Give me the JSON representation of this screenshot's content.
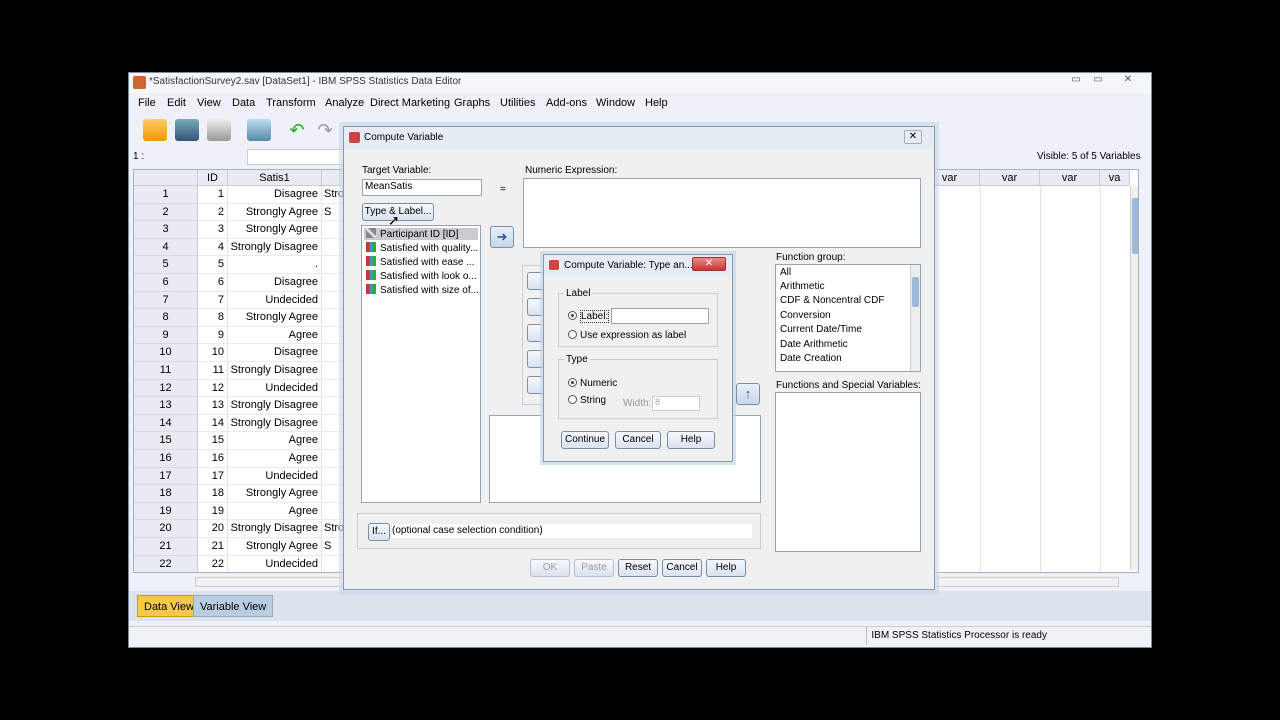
{
  "window": {
    "title": "*SatisfactionSurvey2.sav [DataSet1] - IBM SPSS Statistics Data Editor",
    "controls": {
      "minimize": "▭",
      "maximize": "▭",
      "close": "✕"
    }
  },
  "menu": [
    "File",
    "Edit",
    "View",
    "Data",
    "Transform",
    "Analyze",
    "Direct Marketing",
    "Graphs",
    "Utilities",
    "Add-ons",
    "Window",
    "Help"
  ],
  "cell_ref": "1 :",
  "visible": "Visible: 5 of 5 Variables",
  "grid": {
    "columns": [
      "ID",
      "Satis1",
      "var",
      "var",
      "var",
      "va"
    ],
    "rows": [
      {
        "n": "1",
        "id": "1",
        "s1": "Disagree",
        "s2": "Stro"
      },
      {
        "n": "2",
        "id": "2",
        "s1": "Strongly Agree",
        "s2": "S"
      },
      {
        "n": "3",
        "id": "3",
        "s1": "Strongly Agree",
        "s2": ""
      },
      {
        "n": "4",
        "id": "4",
        "s1": "Strongly Disagree",
        "s2": ""
      },
      {
        "n": "5",
        "id": "5",
        "s1": ".",
        "s2": ""
      },
      {
        "n": "6",
        "id": "6",
        "s1": "Disagree",
        "s2": ""
      },
      {
        "n": "7",
        "id": "7",
        "s1": "Undecided",
        "s2": ""
      },
      {
        "n": "8",
        "id": "8",
        "s1": "Strongly Agree",
        "s2": ""
      },
      {
        "n": "9",
        "id": "9",
        "s1": "Agree",
        "s2": ""
      },
      {
        "n": "10",
        "id": "10",
        "s1": "Disagree",
        "s2": ""
      },
      {
        "n": "11",
        "id": "11",
        "s1": "Strongly Disagree",
        "s2": ""
      },
      {
        "n": "12",
        "id": "12",
        "s1": "Undecided",
        "s2": ""
      },
      {
        "n": "13",
        "id": "13",
        "s1": "Strongly Disagree",
        "s2": ""
      },
      {
        "n": "14",
        "id": "14",
        "s1": "Strongly Disagree",
        "s2": ""
      },
      {
        "n": "15",
        "id": "15",
        "s1": "Agree",
        "s2": ""
      },
      {
        "n": "16",
        "id": "16",
        "s1": "Agree",
        "s2": ""
      },
      {
        "n": "17",
        "id": "17",
        "s1": "Undecided",
        "s2": ""
      },
      {
        "n": "18",
        "id": "18",
        "s1": "Strongly Agree",
        "s2": ""
      },
      {
        "n": "19",
        "id": "19",
        "s1": "Agree",
        "s2": ""
      },
      {
        "n": "20",
        "id": "20",
        "s1": "Strongly Disagree",
        "s2": "Stro"
      },
      {
        "n": "21",
        "id": "21",
        "s1": "Strongly Agree",
        "s2": "S"
      },
      {
        "n": "22",
        "id": "22",
        "s1": "Undecided",
        "s2": ""
      }
    ]
  },
  "view_tabs": {
    "data": "Data View",
    "variable": "Variable View"
  },
  "status": "IBM SPSS Statistics Processor is ready",
  "compute": {
    "title": "Compute Variable",
    "target_label": "Target Variable:",
    "target_value": "MeanSatis",
    "equals": "=",
    "expr_label": "Numeric Expression:",
    "type_label_btn": "Type & Label...",
    "variables": [
      "Participant ID [ID]",
      "Satisfied with quality...",
      "Satisfied with ease ...",
      "Satisfied with look o...",
      "Satisfied with size of..."
    ],
    "function_group_label": "Function group:",
    "function_groups": [
      "All",
      "Arithmetic",
      "CDF & Noncentral CDF",
      "Conversion",
      "Current Date/Time",
      "Date Arithmetic",
      "Date Creation"
    ],
    "functions_label": "Functions and Special Variables:",
    "if_btn": "If...",
    "if_text": "(optional case selection condition)",
    "buttons": {
      "ok": "OK",
      "paste": "Paste",
      "reset": "Reset",
      "cancel": "Cancel",
      "help": "Help"
    }
  },
  "type_label": {
    "title": "Compute Variable: Type an...",
    "label_group": "Label",
    "label_opt": "Label:",
    "use_expr_opt": "Use expression as label",
    "type_group": "Type",
    "numeric_opt": "Numeric",
    "string_opt": "String",
    "width_label": "Width:",
    "width_value": "8",
    "buttons": {
      "continue": "Continue",
      "cancel": "Cancel",
      "help": "Help"
    }
  }
}
